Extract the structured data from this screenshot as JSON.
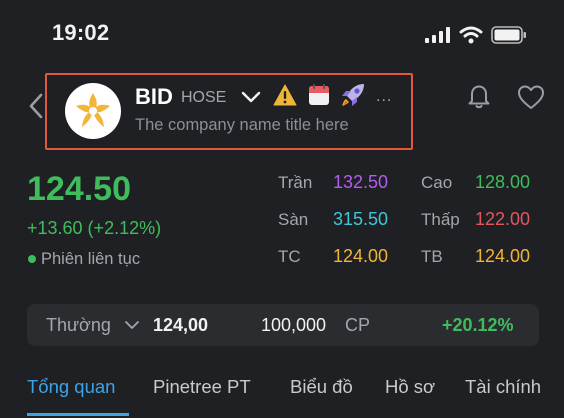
{
  "status_bar": {
    "time": "19:02",
    "icons": [
      "signal-icon",
      "wifi-icon",
      "battery-icon"
    ]
  },
  "header": {
    "ticker": "BID",
    "exchange": "HOSE",
    "company_name": "The company name title here",
    "more": "...",
    "icons": [
      "back-icon",
      "logo-icon",
      "chevron-down-icon",
      "warning-icon",
      "calendar-icon",
      "rocket-icon",
      "bell-icon",
      "heart-icon"
    ]
  },
  "quote": {
    "price": "124.50",
    "change": "+13.60 (+2.12%)",
    "session": "Phiên liên tục",
    "stats": [
      {
        "label": "Trần",
        "value": "132.50",
        "color": "#b15df0"
      },
      {
        "label": "Cao",
        "value": "128.00",
        "color": "#3fbd5c"
      },
      {
        "label": "Sàn",
        "value": "315.50",
        "color": "#3fc7d9"
      },
      {
        "label": "Thấp",
        "value": "122.00",
        "color": "#e3585f"
      },
      {
        "label": "TC",
        "value": "124.00",
        "color": "#f0b536"
      },
      {
        "label": "TB",
        "value": "124.00",
        "color": "#f0b536"
      }
    ]
  },
  "order": {
    "type": "Thường",
    "price": "124,00",
    "quantity": "100,000",
    "unit": "CP",
    "percent": "+20.12%"
  },
  "tabs": [
    "Tổng quan",
    "Pinetree PT",
    "Biểu đồ",
    "Hồ sơ",
    "Tài chính"
  ],
  "colors": {
    "accent": "#3ea2e8",
    "up": "#3fbd5c",
    "highlight_border": "#e2583a",
    "background": "#1f2023"
  }
}
